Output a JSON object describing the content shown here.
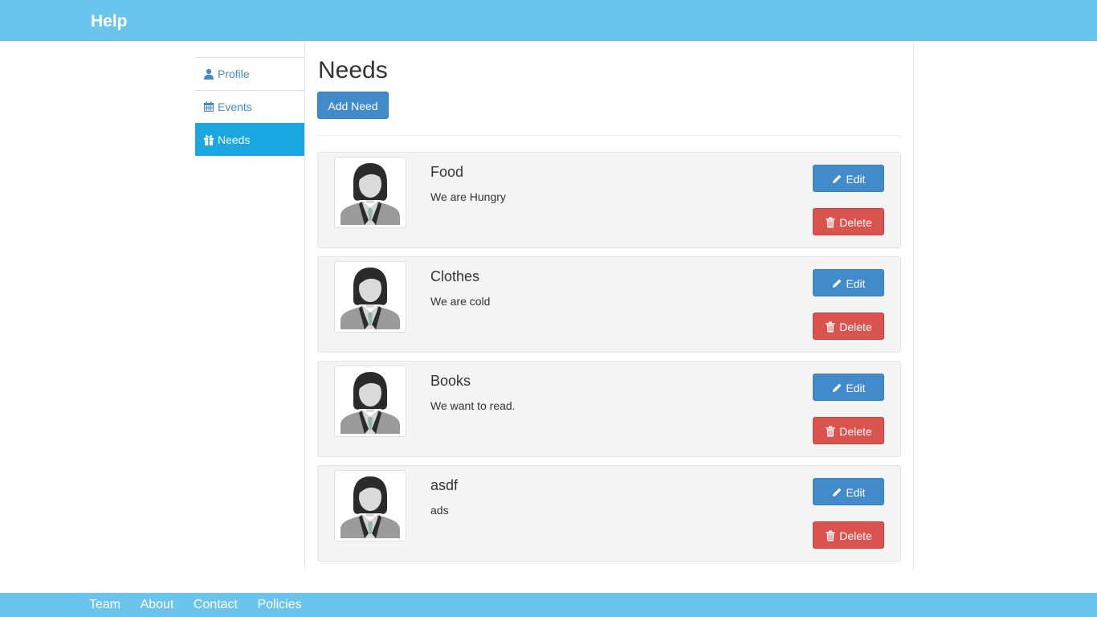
{
  "navbar": {
    "brand": "Help"
  },
  "sidebar": {
    "items": [
      {
        "label": "Profile",
        "icon": "user-icon",
        "active": false
      },
      {
        "label": "Events",
        "icon": "calendar-icon",
        "active": false
      },
      {
        "label": "Needs",
        "icon": "gift-icon",
        "active": true
      }
    ]
  },
  "main": {
    "title": "Needs",
    "add_button": "Add Need",
    "needs": [
      {
        "title": "Food",
        "description": "We are Hungry",
        "avatar": "person-avatar-icon"
      },
      {
        "title": "Clothes",
        "description": "We are cold",
        "avatar": "person-avatar-icon"
      },
      {
        "title": "Books",
        "description": "We want to read.",
        "avatar": "person-avatar-icon"
      },
      {
        "title": "asdf",
        "description": "ads",
        "avatar": "person-avatar-icon"
      }
    ],
    "edit_label": "Edit",
    "delete_label": "Delete",
    "edit_icon": "pencil-icon",
    "delete_icon": "trash-icon"
  },
  "footer": {
    "links": [
      "Team",
      "About",
      "Contact",
      "Policies"
    ]
  },
  "colors": {
    "navbar": "#6ac4ec",
    "sidebar_active": "#1aa6df",
    "primary": "#428bca",
    "danger": "#d9534f",
    "card_bg": "#f4f4f4"
  }
}
